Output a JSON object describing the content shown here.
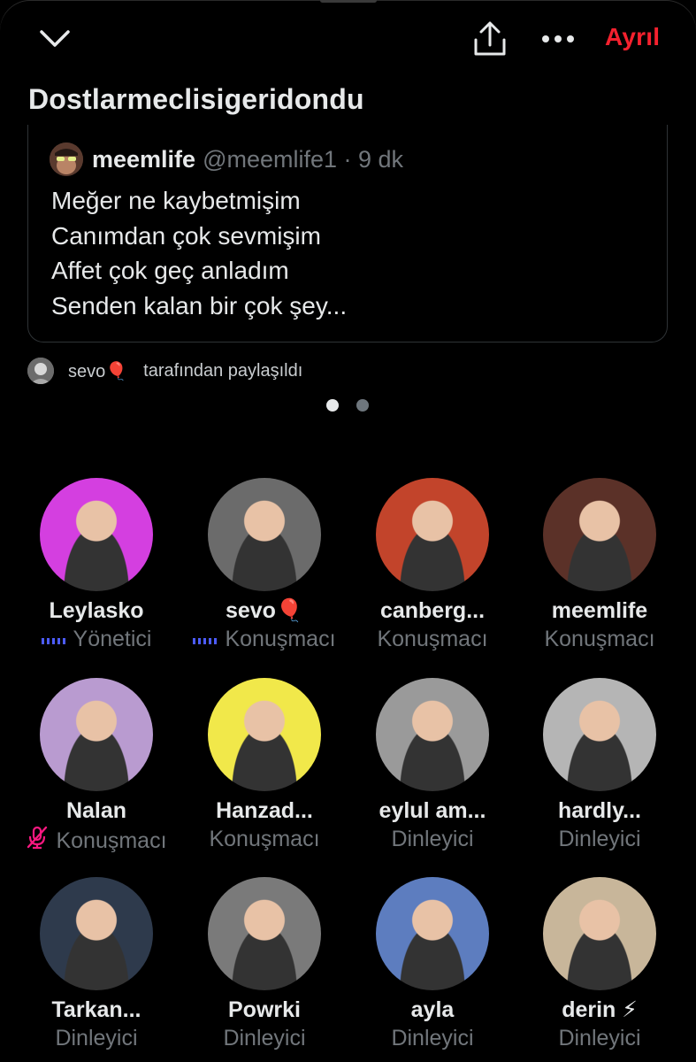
{
  "header": {
    "leave_label": "Ayrıl",
    "space_title": "Dostlarmeclisigeridondu"
  },
  "pinned_tweet": {
    "author_name": "meemlife",
    "author_handle": "@meemlife1 · 9 dk",
    "lines": [
      "Meğer ne kaybetmişim",
      "Canımdan çok sevmişim",
      "Affet çok geç anladım",
      "Senden kalan bir çok şey..."
    ]
  },
  "shared_by": {
    "name": "sevo🎈",
    "suffix": "tarafından paylaşıldı"
  },
  "pager": {
    "total": 2,
    "active": 1
  },
  "accent_colors": {
    "leave": "#f4212e",
    "speaking": "#4c5cff",
    "muted": "#f91880"
  },
  "participants": [
    {
      "name": "Leylasko",
      "role": "Yönetici",
      "role_icon": "speaking-bars-icon",
      "avatar_color": "#d43fe0"
    },
    {
      "name": "sevo🎈",
      "role": "Konuşmacı",
      "role_icon": "speaking-bars-icon",
      "avatar_color": "#6b6b6b"
    },
    {
      "name": "canberg...",
      "role": "Konuşmacı",
      "role_icon": "",
      "avatar_color": "#c2442b"
    },
    {
      "name": "meemlife",
      "role": "Konuşmacı",
      "role_icon": "",
      "avatar_color": "#5b3128"
    },
    {
      "name": "Nalan",
      "role": "Konuşmacı",
      "role_icon": "mic-muted-icon",
      "avatar_color": "#b99bd0"
    },
    {
      "name": "Hanzad...",
      "role": "Konuşmacı",
      "role_icon": "",
      "avatar_color": "#f1e84a"
    },
    {
      "name": "eylul am...",
      "role": "Dinleyici",
      "role_icon": "",
      "avatar_color": "#9a9a9a"
    },
    {
      "name": "hardly...",
      "role": "Dinleyici",
      "role_icon": "",
      "avatar_color": "#b5b5b5"
    },
    {
      "name": "Tarkan...",
      "role": "Dinleyici",
      "role_icon": "",
      "avatar_color": "#2e3a4c"
    },
    {
      "name": "Powrki",
      "role": "Dinleyici",
      "role_icon": "",
      "avatar_color": "#7a7a7a"
    },
    {
      "name": "ayla",
      "role": "Dinleyici",
      "role_icon": "",
      "avatar_color": "#5d7dbf"
    },
    {
      "name": "derin ⚡",
      "role": "Dinleyici",
      "role_icon": "",
      "avatar_color": "#c8b69a"
    }
  ]
}
